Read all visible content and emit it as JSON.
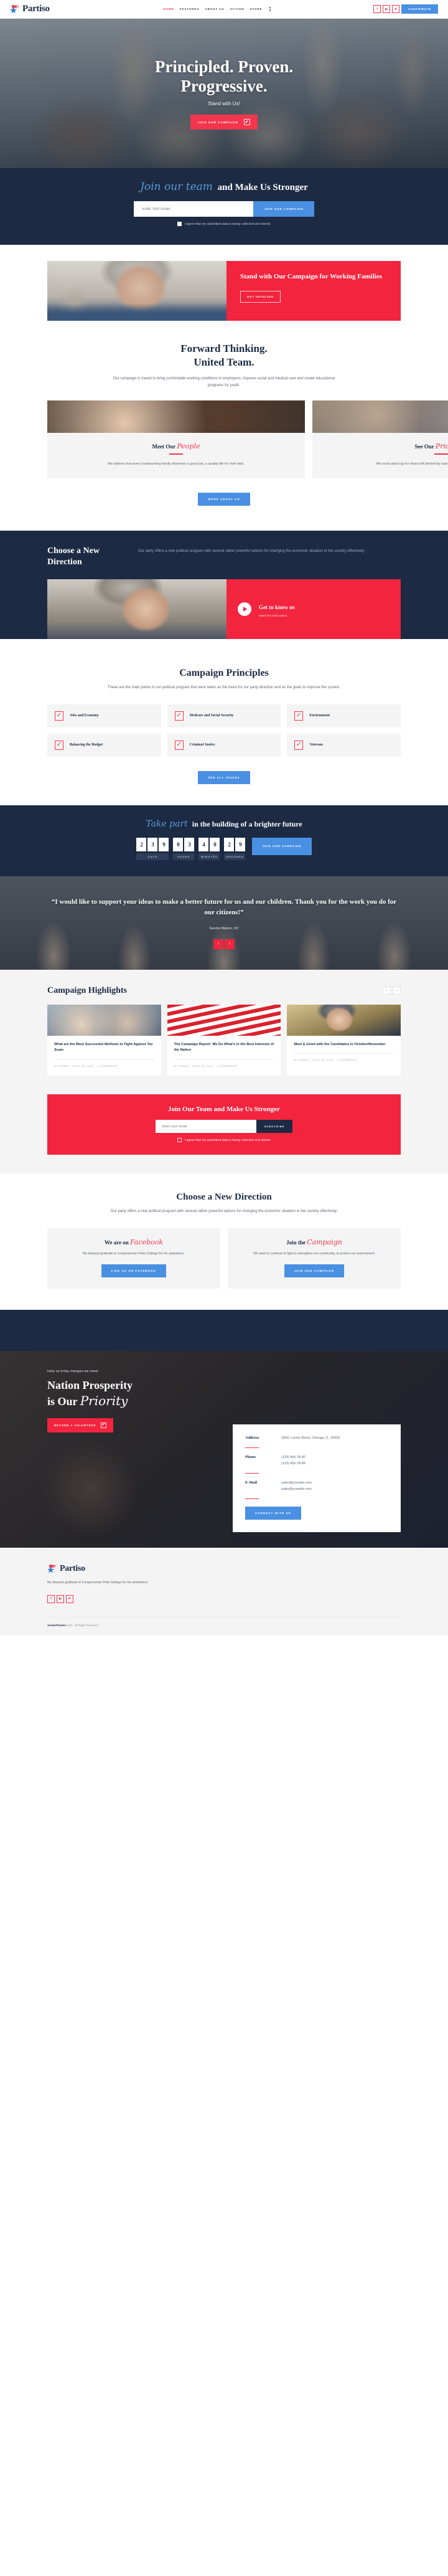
{
  "brand": {
    "name": "Partiso",
    "logo_icon": "star-swoosh-logo"
  },
  "header": {
    "nav": [
      {
        "label": "HOME",
        "active": true
      },
      {
        "label": "FEATURES",
        "active": false
      },
      {
        "label": "ABOUT US",
        "active": false
      },
      {
        "label": "ACTION",
        "active": false
      },
      {
        "label": "STORE",
        "active": false
      }
    ],
    "more_icon": "vertical-dots-icon",
    "social": [
      {
        "icon": "facebook-icon",
        "glyph": "f"
      },
      {
        "icon": "youtube-icon",
        "glyph": "▶"
      },
      {
        "icon": "twitter-icon",
        "glyph": "✐"
      }
    ],
    "contribute_label": "CONTRIBUTE"
  },
  "hero": {
    "title_line1": "Principled. Proven.",
    "title_line2": "Progressive.",
    "subtitle": "Stand with Us!",
    "cta_label": "JOIN OUR CAMPAIGN",
    "cta_icon": "check-box-icon",
    "cta_glyph": "✔"
  },
  "join_band": {
    "script_part": "Join our team",
    "rest_part": " and Make Us Stronger",
    "email_placeholder": "Enter Your Email",
    "button_label": "JOIN OUR CAMPAIGN",
    "consent_text": "I agree that my submitted data is being collected and stored."
  },
  "stand": {
    "title": "Stand with Our Campaign for Working Families",
    "button_label": "GET INVOLVED",
    "image_alt": "smiling-woman-portrait"
  },
  "forward": {
    "title_line1": "Forward Thinking.",
    "title_line2": "United Team.",
    "description": "Our campaign is meant to bring comfortable working conditions to employees, improve social and medical care and create educational programs for youth.",
    "cards": [
      {
        "title_plain": "Meet Our ",
        "title_script": "People",
        "text": "We believe that every hardworking family deserves a good job, a quality life for their kids.",
        "image_alt": "cheering-crowd-photo"
      },
      {
        "title_plain": "See Our ",
        "title_script": "Priorities",
        "text": "We must stand up for those left behind by automation, and a broken political system.",
        "image_alt": "supporters-photo"
      }
    ],
    "button_label": "MORE ABOUT US"
  },
  "direction": {
    "title": "Choose a New Direction",
    "description": "Our party offers a new political program with several rather powerful options for changing the economic situation in the country effectively.",
    "video": {
      "play_icon": "play-triangle-icon",
      "title": "Get to know us",
      "subtitle": "watch the video below"
    }
  },
  "principles": {
    "title": "Campaign Principles",
    "subtitle": "These are the main points in our political program that were taken as the basis for our party direction and as the goals to improve the system.",
    "items": [
      "Jobs and Economy",
      "Medcare and Social Security",
      "Environment",
      "Balancing the Budget",
      "Criminal Justice",
      "Veterans"
    ],
    "check_glyph": "✓",
    "button_label": "SEE ALL ISSUES"
  },
  "countdown": {
    "script_part": "Take part",
    "rest_part": " in the building of a brighter future",
    "units": [
      {
        "label": "DAYS",
        "digits": [
          "2",
          "3",
          "9"
        ]
      },
      {
        "label": "HOURS",
        "digits": [
          "0",
          "3"
        ]
      },
      {
        "label": "MINUTES",
        "digits": [
          "4",
          "0"
        ]
      },
      {
        "label": "SECONDS",
        "digits": [
          "2",
          "9"
        ]
      }
    ],
    "button_label": "JOIN OUR CAMPAIGN"
  },
  "testimonial": {
    "quote": "“I would like to support your ideas to make a better future for us and our children. Thank you for the work you do for our citizens!”",
    "author": "Sandra Watson,  NY",
    "prev_icon": "chevron-left-icon",
    "next_icon": "chevron-right-icon",
    "prev_glyph": "‹",
    "next_glyph": "›"
  },
  "highlights": {
    "title": "Campaign Highlights",
    "prev_glyph": "‹",
    "next_glyph": "›",
    "posts": [
      {
        "title": "What are the Most Successful Methods to Fight Against Tax Scam",
        "meta": "BY ADMIN · JUNE 25, 2021 · 0 COMMENTS",
        "image_alt": "crowd-hands-raised"
      },
      {
        "title": "The Campaign Report: We Do What's in the Best Interests of the Nation",
        "meta": "BY ADMIN · JUNE 25, 2021 · 0 COMMENTS",
        "image_alt": "american-flag"
      },
      {
        "title": "Meet & Greet with the Candidates in October/November",
        "meta": "BY ADMIN · JUNE 25, 2021 · 0 COMMENTS",
        "image_alt": "candidate-portrait"
      }
    ]
  },
  "join_red": {
    "title": "Join Our Team and Make Us Stronger",
    "email_placeholder": "Enter your email",
    "button_label": "SUBSCRIBE",
    "consent_text": "I agree that my submitted data is being collected and stored."
  },
  "choose_direction": {
    "title": "Choose a New Direction",
    "subtitle": "Our party offers a new political program with several rather powerful options for changing the economic situation in the country effectively.",
    "cards": [
      {
        "title_plain": "We are on ",
        "title_script": "Facebook",
        "text": "My deepest gratitude to Congressman Peter Gallego for his assistance.",
        "button_label": "LIKE US ON FACEBOOK"
      },
      {
        "title_plain": "Join the ",
        "title_script": "Campaign",
        "text": "We want to continue to fight to strengthen our community, to protect our environment.",
        "button_label": "JOIN OUR CAMPAIGN"
      }
    ]
  },
  "prosperity": {
    "kicker": "Help us bring changes we need",
    "title_line1": "Nation Prosperity",
    "title_plain": "is Our ",
    "title_script": "Priority",
    "button_label": "BECOME A VOLUNTEER",
    "button_glyph": "✔",
    "contact": {
      "rows": [
        {
          "label": "Address",
          "value": "1600, Lorem Street, Chicago, IL, 55030"
        },
        {
          "label": "Phone",
          "value": "(123) 456-78-90\n(123) 456-78-88"
        },
        {
          "label": "E-Mail",
          "value": "sales@yoursite.com\nsales@yoursite.com"
        }
      ],
      "button_label": "CONNECT WITH US"
    }
  },
  "footer": {
    "note": "My deepest gratitude to Congressman Pete Gallego for his assistance.",
    "social": [
      {
        "icon": "facebook-icon",
        "glyph": "f"
      },
      {
        "icon": "youtube-icon",
        "glyph": "▶"
      },
      {
        "icon": "twitter-icon",
        "glyph": "✐"
      }
    ],
    "copyright_brand": "AxiomThemes",
    "copyright_rest": " 2021. All Rights Reserved."
  },
  "colors": {
    "red": "#f3243e",
    "pink_red": "#f3364e",
    "blue": "#4a90e2",
    "navy": "#1c2a44",
    "light_gray": "#f4f4f4"
  }
}
